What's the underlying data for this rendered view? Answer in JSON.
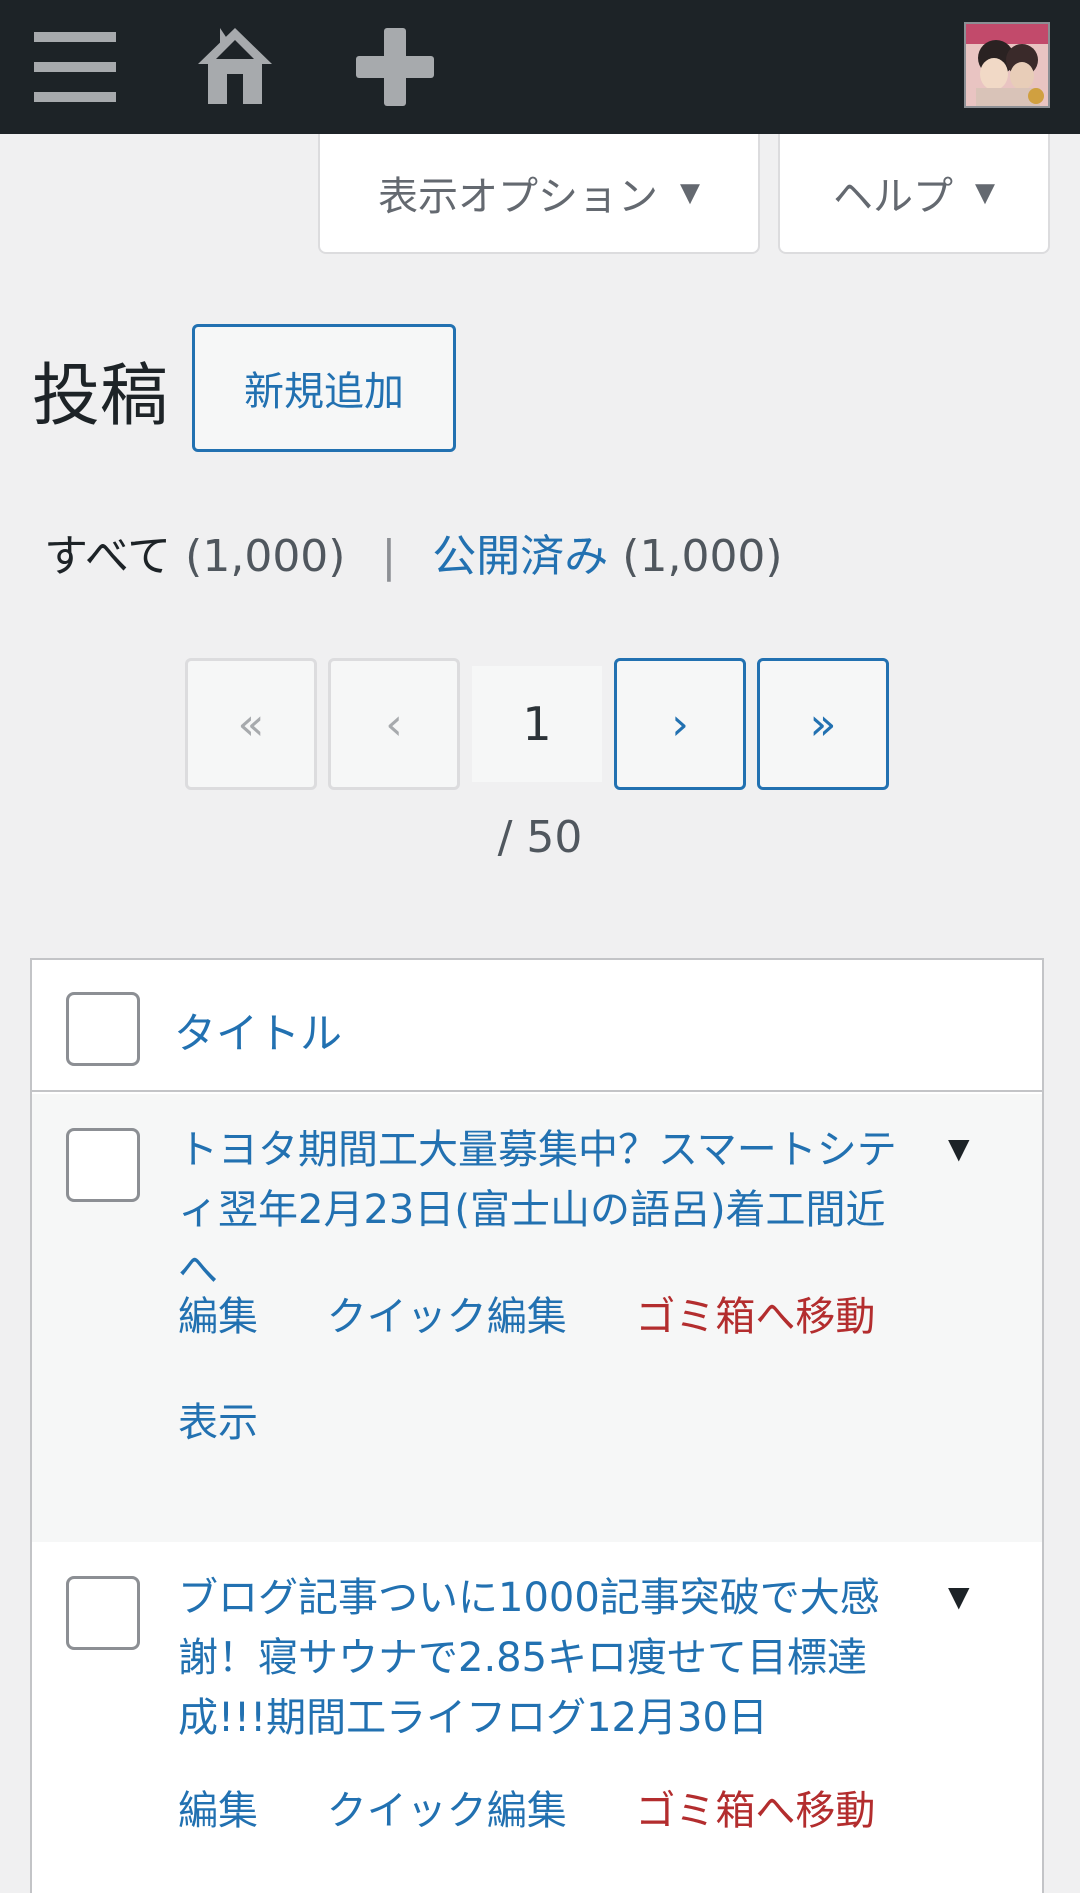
{
  "adminbar": {
    "menu_icon": "hamburger-menu-icon",
    "home_icon": "home-icon",
    "add_icon": "plus-icon",
    "avatar": "user-avatar"
  },
  "screen_meta": {
    "options_label": "表示オプション",
    "help_label": "ヘルプ"
  },
  "heading": {
    "title": "投稿",
    "add_new": "新規追加"
  },
  "filters": {
    "all_label": "すべて",
    "all_count": "(1,000)",
    "separator": "|",
    "published_label": "公開済み",
    "published_count": "(1,000)"
  },
  "pagination": {
    "first": "«",
    "prev": "‹",
    "current": "1",
    "next": "›",
    "last": "»",
    "total": "/ 50"
  },
  "table": {
    "column_title": "タイトル",
    "rows": [
      {
        "title": "トヨタ期間工大量募集中？スマートシティ翌年2月23日(富士山の語呂)着工間近へ",
        "actions": {
          "edit": "編集",
          "quick_edit": "クイック編集",
          "trash": "ゴミ箱へ移動",
          "view": "表示"
        }
      },
      {
        "title": "ブログ記事ついに1000記事突破で大感謝！寝サウナで2.85キロ痩せて目標達成!!!期間工ライフログ12月30日",
        "actions": {
          "edit": "編集",
          "quick_edit": "クイック編集",
          "trash": "ゴミ箱へ移動"
        }
      }
    ]
  },
  "colors": {
    "adminbar_bg": "#1d2327",
    "link": "#2271b1",
    "trash": "#b32d2e",
    "page_bg": "#f0f0f1"
  }
}
